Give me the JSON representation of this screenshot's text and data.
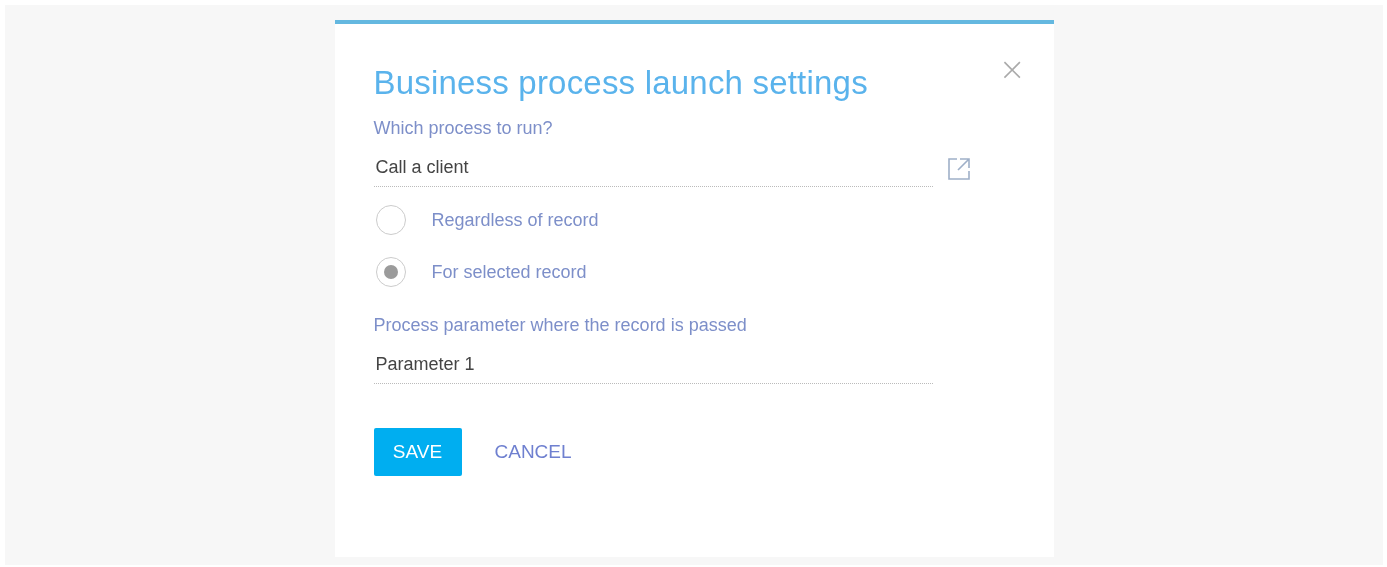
{
  "dialog": {
    "title": "Business process launch settings",
    "close": "×"
  },
  "process_field": {
    "label": "Which process to run?",
    "value": "Call a client"
  },
  "run_modes": [
    {
      "label": "Regardless of record",
      "selected": false
    },
    {
      "label": "For selected record",
      "selected": true
    }
  ],
  "parameter_field": {
    "label": "Process parameter where the record is passed",
    "value": "Parameter 1"
  },
  "buttons": [
    {
      "label": "SAVE",
      "kind": "primary"
    },
    {
      "label": "CANCEL",
      "kind": "link"
    }
  ]
}
